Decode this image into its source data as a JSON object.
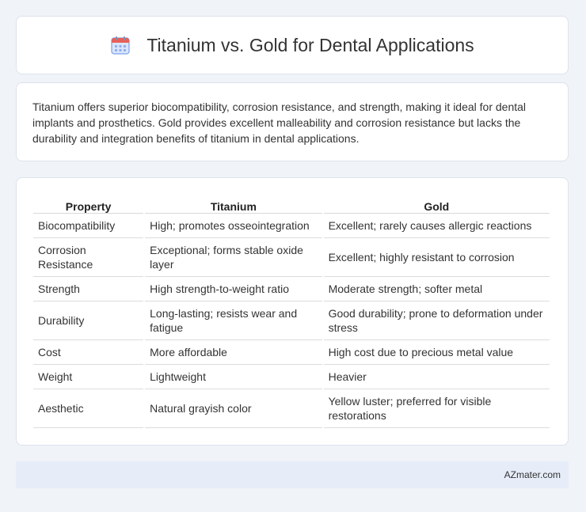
{
  "header": {
    "title": "Titanium vs. Gold for Dental Applications",
    "icon": "calendar-icon"
  },
  "summary": {
    "text": "Titanium offers superior biocompatibility, corrosion resistance, and strength, making it ideal for dental implants and prosthetics. Gold provides excellent malleability and corrosion resistance but lacks the durability and integration benefits of titanium in dental applications."
  },
  "table": {
    "headers": [
      "Property",
      "Titanium",
      "Gold"
    ],
    "rows": [
      [
        "Biocompatibility",
        "High; promotes osseointegration",
        "Excellent; rarely causes allergic reactions"
      ],
      [
        "Corrosion Resistance",
        "Exceptional; forms stable oxide layer",
        "Excellent; highly resistant to corrosion"
      ],
      [
        "Strength",
        "High strength-to-weight ratio",
        "Moderate strength; softer metal"
      ],
      [
        "Durability",
        "Long-lasting; resists wear and fatigue",
        "Good durability; prone to deformation under stress"
      ],
      [
        "Cost",
        "More affordable",
        "High cost due to precious metal value"
      ],
      [
        "Weight",
        "Lightweight",
        "Heavier"
      ],
      [
        "Aesthetic",
        "Natural grayish color",
        "Yellow luster; preferred for visible restorations"
      ]
    ]
  },
  "footer": {
    "text": "AZmater.com"
  },
  "colors": {
    "background": "#f0f3f8",
    "card": "#ffffff",
    "footer_bg": "#e6edf8",
    "icon_blue": "#5b8def",
    "icon_red": "#e8605a"
  }
}
